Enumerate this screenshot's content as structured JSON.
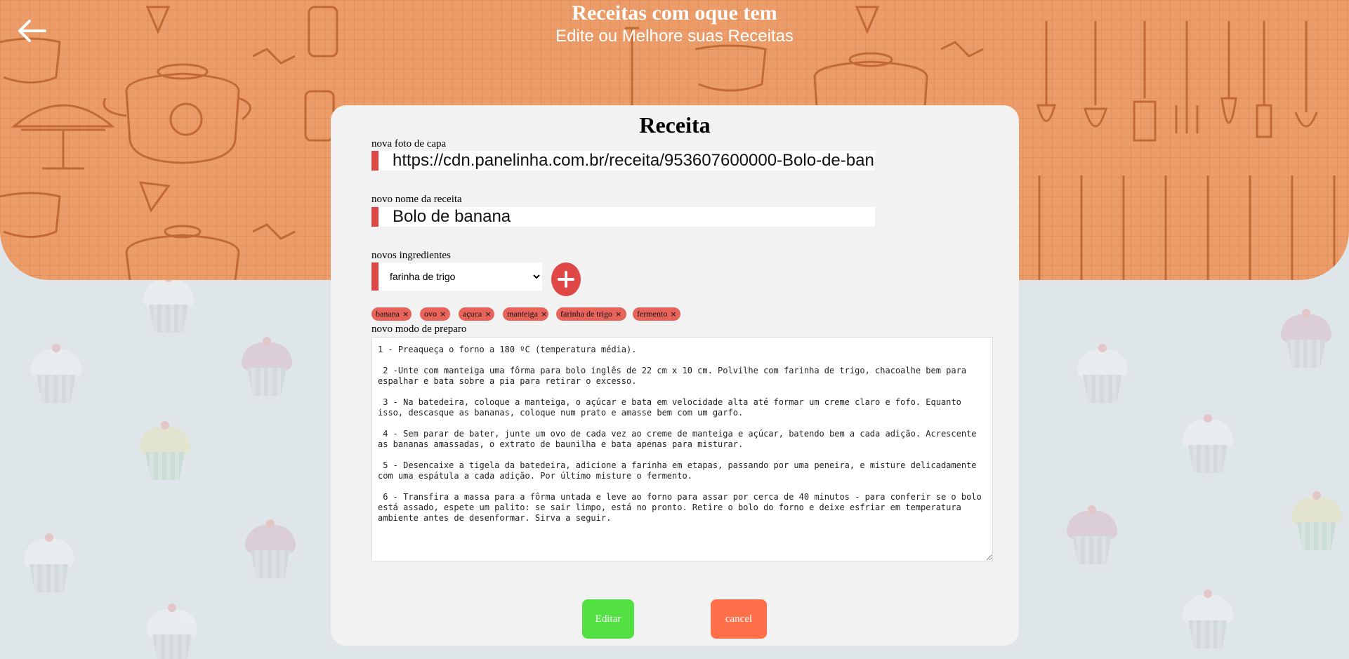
{
  "header": {
    "title": "Receitas com oque tem",
    "subtitle": "Edite ou Melhore suas Receitas",
    "back_icon": "arrow-left-icon"
  },
  "card": {
    "title": "Receita",
    "cover_label": "nova foto de capa",
    "cover_value": "https://cdn.panelinha.com.br/receita/953607600000-Bolo-de-bana",
    "name_label": "novo nome da receita",
    "name_value": "Bolo de banana",
    "ingredients_label": "novos ingredientes",
    "ingredient_selected": "farinha de trigo",
    "add_icon": "plus-icon",
    "chips": [
      "banana",
      "ovo",
      "açuca",
      "manteiga",
      "farinha de trigo",
      "fermento"
    ],
    "prep_label": "novo modo de preparo",
    "prep_text": "1 - Preaqueça o forno a 180 ºC (temperatura média).\n\n 2 -Unte com manteiga uma fôrma para bolo inglês de 22 cm x 10 cm. Polvilhe com farinha de trigo, chacoalhe bem para espalhar e bata sobre a pia para retirar o excesso.\n\n 3 - Na batedeira, coloque a manteiga, o açúcar e bata em velocidade alta até formar um creme claro e fofo. Equanto isso, descasque as bananas, coloque num prato e amasse bem com um garfo.\n\n 4 - Sem parar de bater, junte um ovo de cada vez ao creme de manteiga e açúcar, batendo bem a cada adição. Acrescente as bananas amassadas, o extrato de baunilha e bata apenas para misturar.\n\n 5 - Desencaixe a tigela da batedeira, adicione a farinha em etapas, passando por uma peneira, e misture delicadamente com uma espátula a cada adição. Por último misture o fermento.\n\n 6 - Transfira a massa para a fôrma untada e leve ao forno para assar por cerca de 40 minutos - para conferir se o bolo está assado, espete um palito: se sair limpo, está no pronto. Retire o bolo do forno e deixe esfriar em temperatura ambiente antes de desenformar. Sirva a seguir.",
    "edit_label": "Editar",
    "cancel_label": "cancel"
  },
  "colors": {
    "header_orange": "#ec9c68",
    "accent_red": "#e04848",
    "chip_red": "#e8635a",
    "edit_green": "#52e043",
    "cancel_orange": "#ff6f4a",
    "page_bg": "#dfe6ea",
    "card_bg": "#f2f2f2"
  }
}
